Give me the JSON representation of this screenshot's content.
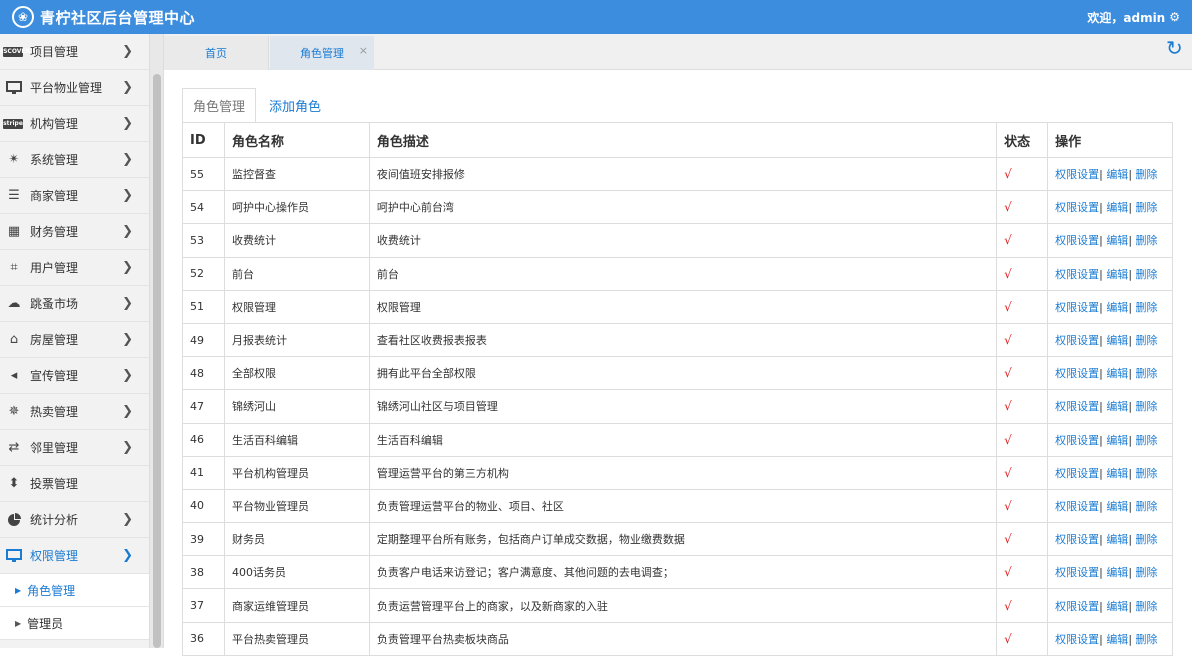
{
  "header": {
    "title": "青柠社区后台管理中心",
    "welcome": "欢迎，admin",
    "logo_icon": "leaf-logo-icon",
    "gear_icon": "gear-icon"
  },
  "sidebar": {
    "items": [
      {
        "label": "项目管理",
        "icon": "card-icon"
      },
      {
        "label": "平台物业管理",
        "icon": "monitor-icon"
      },
      {
        "label": "机构管理",
        "icon": "stripe-icon"
      },
      {
        "label": "系统管理",
        "icon": "yelp-icon"
      },
      {
        "label": "商家管理",
        "icon": "list-icon"
      },
      {
        "label": "财务管理",
        "icon": "calculator-icon"
      },
      {
        "label": "用户管理",
        "icon": "crop-icon"
      },
      {
        "label": "跳蚤市场",
        "icon": "cloud-icon"
      },
      {
        "label": "房屋管理",
        "icon": "bank-icon"
      },
      {
        "label": "宣传管理",
        "icon": "volume-icon"
      },
      {
        "label": "热卖管理",
        "icon": "sun-icon"
      },
      {
        "label": "邻里管理",
        "icon": "retweet-icon"
      },
      {
        "label": "投票管理",
        "icon": "sort-icon"
      },
      {
        "label": "统计分析",
        "icon": "pie-chart-icon"
      },
      {
        "label": "权限管理",
        "icon": "desktop-icon"
      }
    ],
    "sub_items": [
      {
        "label": "角色管理"
      },
      {
        "label": "管理员"
      }
    ],
    "card_badge": "DISCOVER",
    "stripe_badge": "stripe"
  },
  "tabs": {
    "home": "首页",
    "role": "角色管理",
    "close": "×"
  },
  "subtabs": {
    "active": "角色管理",
    "add": "添加角色"
  },
  "table": {
    "headers": [
      "ID",
      "角色名称",
      "角色描述",
      "状态",
      "操作"
    ],
    "ops": {
      "perm": "权限设置",
      "edit": "编辑",
      "del": "删除",
      "sep": "|"
    },
    "check": "√",
    "rows": [
      {
        "id": "55",
        "name": "监控督查",
        "desc": "夜间值班安排报修"
      },
      {
        "id": "54",
        "name": "呵护中心操作员",
        "desc": "呵护中心前台湾"
      },
      {
        "id": "53",
        "name": "收费统计",
        "desc": "收费统计"
      },
      {
        "id": "52",
        "name": "前台",
        "desc": "前台"
      },
      {
        "id": "51",
        "name": "权限管理",
        "desc": "权限管理"
      },
      {
        "id": "49",
        "name": "月报表统计",
        "desc": "查看社区收费报表报表"
      },
      {
        "id": "48",
        "name": "全部权限",
        "desc": "拥有此平台全部权限"
      },
      {
        "id": "47",
        "name": "锦绣河山",
        "desc": "锦绣河山社区与项目管理"
      },
      {
        "id": "46",
        "name": "生活百科编辑",
        "desc": "生活百科编辑"
      },
      {
        "id": "41",
        "name": "平台机构管理员",
        "desc": "管理运营平台的第三方机构"
      },
      {
        "id": "40",
        "name": "平台物业管理员",
        "desc": "负责管理运营平台的物业、项目、社区"
      },
      {
        "id": "39",
        "name": "财务员",
        "desc": "定期整理平台所有账务，包括商户订单成交数据，物业缴费数据"
      },
      {
        "id": "38",
        "name": "400话务员",
        "desc": "负责客户电话来访登记；客户满意度、其他问题的去电调查；"
      },
      {
        "id": "37",
        "name": "商家运维管理员",
        "desc": "负责运营管理平台上的商家，以及新商家的入驻"
      },
      {
        "id": "36",
        "name": "平台热卖管理员",
        "desc": "负责管理平台热卖板块商品"
      }
    ]
  },
  "colors": {
    "accent": "#3c8dde",
    "link": "#1a7bd3",
    "check": "#e02020"
  }
}
